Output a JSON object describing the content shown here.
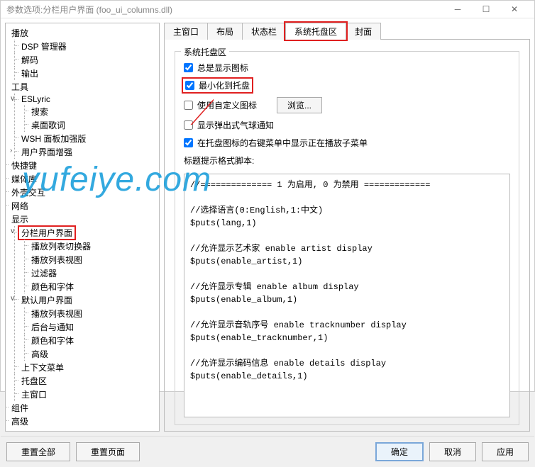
{
  "title": "参数选项:分栏用户界面 (foo_ui_columns.dll)",
  "tree": {
    "playback": {
      "label": "播放",
      "children": {
        "dsp": "DSP 管理器",
        "decode": "解码",
        "output": "输出"
      }
    },
    "tools": {
      "label": "工具",
      "children": {
        "eslyric": {
          "label": "ESLyric",
          "children": {
            "search": "搜索",
            "desktop": "桌面歌词"
          }
        },
        "wsh": "WSH 面板加强版",
        "uienh": "用户界面增强"
      }
    },
    "shortcut": "快捷键",
    "medialib": "媒体库",
    "shell": "外壳交互",
    "network": "网络",
    "display": {
      "label": "显示",
      "children": {
        "columns_ui": {
          "label": "分栏用户界面",
          "children": {
            "switcher": "播放列表切换器",
            "view": "播放列表视图",
            "filter": "过滤器",
            "colorfont": "颜色和字体"
          }
        },
        "default_ui": {
          "label": "默认用户界面",
          "children": {
            "view2": "播放列表视图",
            "backnotify": "后台与通知",
            "colorfont2": "颜色和字体",
            "advanced": "高级"
          }
        },
        "ctxmenu": "上下文菜单",
        "tray": "托盘区",
        "mainwin": "主窗口"
      }
    },
    "components": "组件",
    "advanced2": "高级"
  },
  "tabs": {
    "main": "主窗口",
    "layout": "布局",
    "status": "状态栏",
    "systray": "系统托盘区",
    "cover": "封面"
  },
  "group": {
    "title": "系统托盘区",
    "always_show": "总是显示图标",
    "minimize": "最小化到托盘",
    "custom_icon": "使用自定义图标",
    "browse": "浏览...",
    "balloon": "显示弹出式气球通知",
    "submenu": "在托盘图标的右键菜单中显示正在播放子菜单",
    "script_label": "标题提示格式脚本:"
  },
  "script_lines": [
    "//============== 1 为启用, 0 为禁用 =============",
    "",
    "//选择语言(0:English,1:中文)",
    "$puts(lang,1)",
    "",
    "//允许显示艺术家 enable artist display",
    "$puts(enable_artist,1)",
    "",
    "//允许显示专辑 enable album display",
    "$puts(enable_album,1)",
    "",
    "//允许显示音轨序号 enable tracknumber display",
    "$puts(enable_tracknumber,1)",
    "",
    "//允许显示编码信息 enable details display",
    "$puts(enable_details,1)"
  ],
  "footer": {
    "reset_all": "重置全部",
    "reset_page": "重置页面",
    "ok": "确定",
    "cancel": "取消",
    "apply": "应用"
  },
  "watermark": "yufeiye.com"
}
